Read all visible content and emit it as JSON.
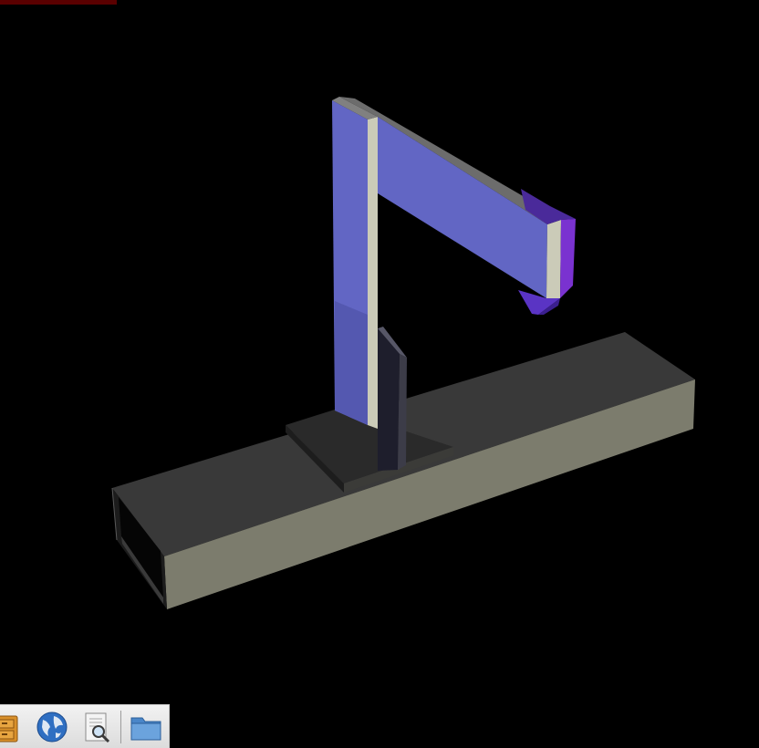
{
  "viewport": {
    "background": "#000000",
    "scene": "3d-bracket-model",
    "colors": {
      "blue_face": "#6266c4",
      "blue_side": "#5458b0",
      "violet_tip": "#6a2fc4",
      "edge_light": "#cbcbb8",
      "gray_top": "#3a3a3a",
      "gray_front": "#7b7b6c",
      "dark_plate": "#252525"
    }
  },
  "taskbar": {
    "buttons": [
      {
        "name": "file-cabinet-icon",
        "label": ""
      },
      {
        "name": "globe-icon",
        "label": ""
      },
      {
        "name": "search-document-icon",
        "label": ""
      },
      {
        "name": "folder-icon",
        "label": ""
      }
    ]
  }
}
